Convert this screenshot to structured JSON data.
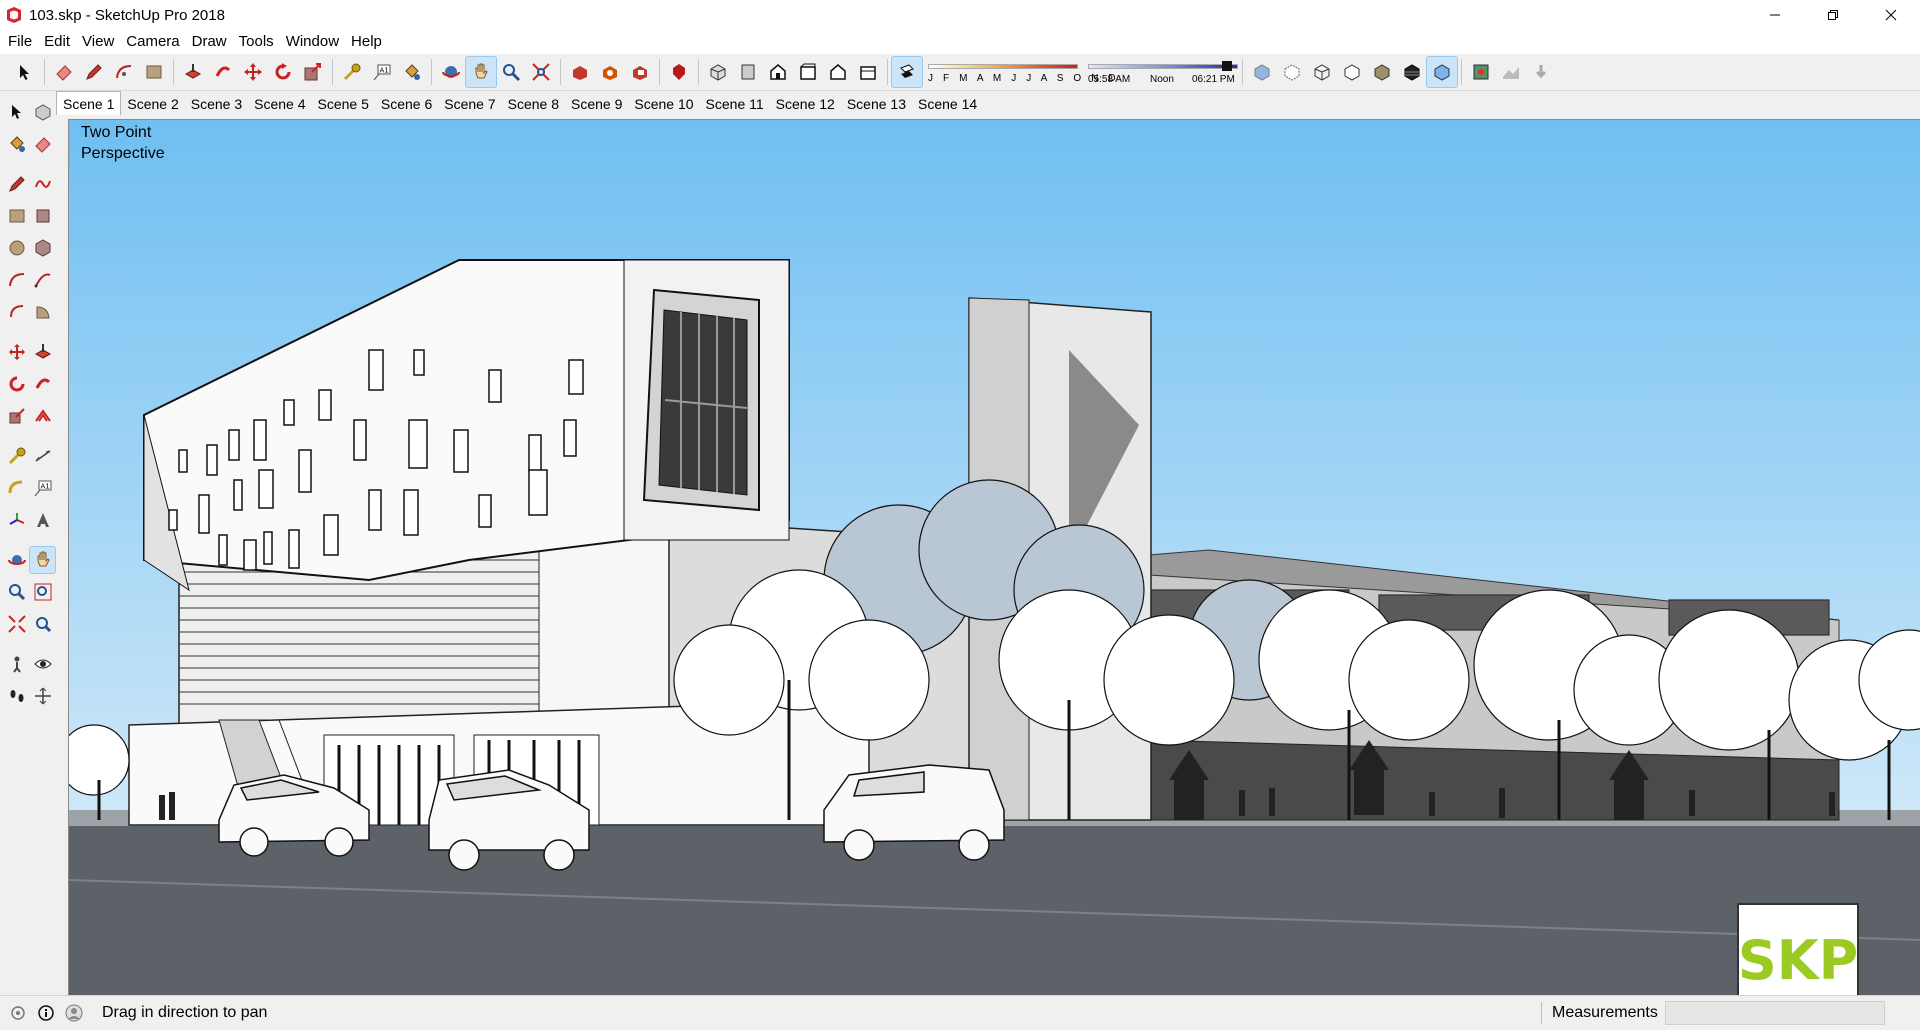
{
  "window": {
    "title": "103.skp - SketchUp Pro 2018"
  },
  "menu": [
    "File",
    "Edit",
    "View",
    "Camera",
    "Draw",
    "Tools",
    "Window",
    "Help"
  ],
  "shadow": {
    "months": "J F M A M J J A S O N D",
    "time_start": "05:58 AM",
    "time_mid": "Noon",
    "time_end": "06:21 PM"
  },
  "scenes": [
    "Scene 1",
    "Scene 2",
    "Scene 3",
    "Scene 4",
    "Scene 5",
    "Scene 6",
    "Scene 7",
    "Scene 8",
    "Scene 9",
    "Scene 10",
    "Scene 11",
    "Scene 12",
    "Scene 13",
    "Scene 14"
  ],
  "active_scene": "Scene 1",
  "viewport": {
    "camera_line1": "Two Point",
    "camera_line2": "Perspective",
    "badge": "SKP"
  },
  "status": {
    "hint": "Drag in direction to pan",
    "measurements_label": "Measurements",
    "measurements_value": ""
  },
  "colors": {
    "sky_top": "#6fbff2",
    "sky_bottom": "#cfe8f8",
    "ground": "#5d6268",
    "accent": "#9bcb23"
  }
}
